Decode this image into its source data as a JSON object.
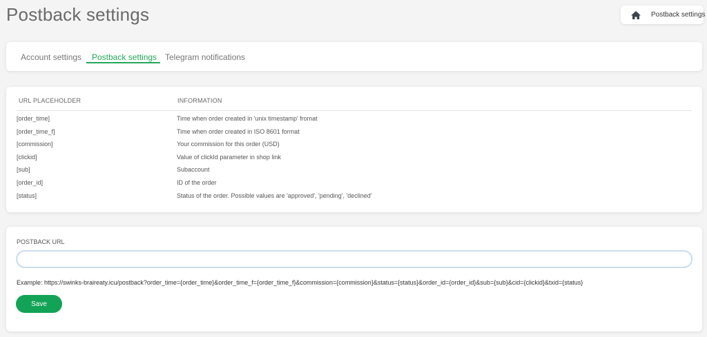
{
  "page": {
    "title": "Postback settings"
  },
  "breadcrumb": {
    "icon": "home-icon",
    "label": "Postback settings"
  },
  "tabs": [
    {
      "label": "Account settings",
      "active": false
    },
    {
      "label": "Postback settings",
      "active": true
    },
    {
      "label": "Telegram notifications",
      "active": false
    }
  ],
  "placeholders_table": {
    "headers": [
      "URL PLACEHOLDER",
      "INFORMATION"
    ],
    "rows": [
      {
        "placeholder": "[order_time]",
        "info": "Time when order created in 'unix timestamp' fromat"
      },
      {
        "placeholder": "[order_time_f]",
        "info": "Time when order created in ISO 8601 format"
      },
      {
        "placeholder": "[commission]",
        "info": "Your commission for this order (USD)"
      },
      {
        "placeholder": "[clickid]",
        "info": "Value of clickId parameter in shop link"
      },
      {
        "placeholder": "[sub]",
        "info": "Subaccount"
      },
      {
        "placeholder": "[order_id]",
        "info": "ID of the order"
      },
      {
        "placeholder": "[status]",
        "info": "Status of the order. Possible values are 'approved', 'pending', 'declined'"
      }
    ]
  },
  "postback": {
    "label": "POSTBACK URL",
    "value": "",
    "placeholder": "",
    "example": "Example: https://swinks-braireaty.icu/postback?order_time={order_time}&order_time_f={order_time_f}&commission={commission}&status={status}&order_id={order_id}&sub={sub}&cid={clickid}&txid={status}",
    "save_label": "Save"
  },
  "colors": {
    "accent": "#22a85a",
    "save_button": "#13a357",
    "input_border": "#c8dcef",
    "background": "#f4f4f4"
  }
}
